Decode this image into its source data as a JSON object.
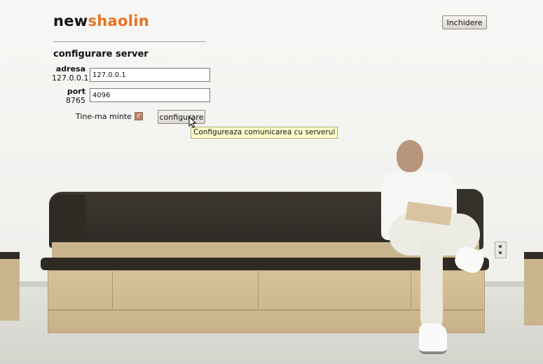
{
  "brand": {
    "part1": "new",
    "part2": "shaolin",
    "accent_color": "#e8731e"
  },
  "header": {
    "close_label": "Inchidere"
  },
  "config": {
    "title": "configurare server",
    "address": {
      "label": "adresa",
      "current": "127.0.0.1",
      "input_value": "127.0.0.1"
    },
    "port": {
      "label": "port",
      "current": "8765",
      "input_value": "4096"
    },
    "remember_label": "Tine-ma minte",
    "remember_checked": true,
    "submit_label": "configurare",
    "tooltip": "Configureaza comunicarea cu serverul"
  },
  "icons": {
    "checkbox": "checkmark-icon",
    "cursor": "mouse-pointer-icon",
    "outlet": "wall-outlet"
  }
}
